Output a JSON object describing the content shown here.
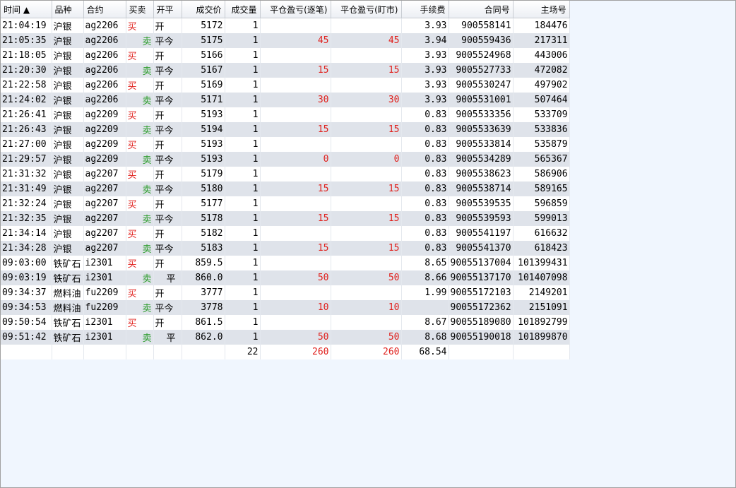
{
  "columns": [
    {
      "key": "time",
      "label": "时间 ▲"
    },
    {
      "key": "product",
      "label": "品种"
    },
    {
      "key": "contract",
      "label": "合约"
    },
    {
      "key": "side",
      "label": "买卖"
    },
    {
      "key": "offset",
      "label": "开平"
    },
    {
      "key": "price",
      "label": "成交价"
    },
    {
      "key": "qty",
      "label": "成交量"
    },
    {
      "key": "pnl_trade",
      "label": "平仓盈亏(逐笔)"
    },
    {
      "key": "pnl_mtm",
      "label": "平仓盈亏(盯市)"
    },
    {
      "key": "fee",
      "label": "手续费"
    },
    {
      "key": "order_no",
      "label": "合同号"
    },
    {
      "key": "exch_no",
      "label": "主场号"
    }
  ],
  "rows": [
    {
      "time": "21:04:19",
      "product": "沪银",
      "contract": "ag2206",
      "side": "买",
      "offset": "开",
      "price": "5172",
      "qty": "1",
      "pnl_trade": "",
      "pnl_mtm": "",
      "fee": "3.93",
      "order_no": "900558141",
      "exch_no": "184476"
    },
    {
      "time": "21:05:35",
      "product": "沪银",
      "contract": "ag2206",
      "side": "卖",
      "offset": "平今",
      "price": "5175",
      "qty": "1",
      "pnl_trade": "45",
      "pnl_mtm": "45",
      "fee": "3.94",
      "order_no": "900559436",
      "exch_no": "217311"
    },
    {
      "time": "21:18:05",
      "product": "沪银",
      "contract": "ag2206",
      "side": "买",
      "offset": "开",
      "price": "5166",
      "qty": "1",
      "pnl_trade": "",
      "pnl_mtm": "",
      "fee": "3.93",
      "order_no": "9005524968",
      "exch_no": "443006"
    },
    {
      "time": "21:20:30",
      "product": "沪银",
      "contract": "ag2206",
      "side": "卖",
      "offset": "平今",
      "price": "5167",
      "qty": "1",
      "pnl_trade": "15",
      "pnl_mtm": "15",
      "fee": "3.93",
      "order_no": "9005527733",
      "exch_no": "472082"
    },
    {
      "time": "21:22:58",
      "product": "沪银",
      "contract": "ag2206",
      "side": "买",
      "offset": "开",
      "price": "5169",
      "qty": "1",
      "pnl_trade": "",
      "pnl_mtm": "",
      "fee": "3.93",
      "order_no": "9005530247",
      "exch_no": "497902"
    },
    {
      "time": "21:24:02",
      "product": "沪银",
      "contract": "ag2206",
      "side": "卖",
      "offset": "平今",
      "price": "5171",
      "qty": "1",
      "pnl_trade": "30",
      "pnl_mtm": "30",
      "fee": "3.93",
      "order_no": "9005531001",
      "exch_no": "507464"
    },
    {
      "time": "21:26:41",
      "product": "沪银",
      "contract": "ag2209",
      "side": "买",
      "offset": "开",
      "price": "5193",
      "qty": "1",
      "pnl_trade": "",
      "pnl_mtm": "",
      "fee": "0.83",
      "order_no": "9005533356",
      "exch_no": "533709"
    },
    {
      "time": "21:26:43",
      "product": "沪银",
      "contract": "ag2209",
      "side": "卖",
      "offset": "平今",
      "price": "5194",
      "qty": "1",
      "pnl_trade": "15",
      "pnl_mtm": "15",
      "fee": "0.83",
      "order_no": "9005533639",
      "exch_no": "533836"
    },
    {
      "time": "21:27:00",
      "product": "沪银",
      "contract": "ag2209",
      "side": "买",
      "offset": "开",
      "price": "5193",
      "qty": "1",
      "pnl_trade": "",
      "pnl_mtm": "",
      "fee": "0.83",
      "order_no": "9005533814",
      "exch_no": "535879"
    },
    {
      "time": "21:29:57",
      "product": "沪银",
      "contract": "ag2209",
      "side": "卖",
      "offset": "平今",
      "price": "5193",
      "qty": "1",
      "pnl_trade": "0",
      "pnl_mtm": "0",
      "fee": "0.83",
      "order_no": "9005534289",
      "exch_no": "565367"
    },
    {
      "time": "21:31:32",
      "product": "沪银",
      "contract": "ag2207",
      "side": "买",
      "offset": "开",
      "price": "5179",
      "qty": "1",
      "pnl_trade": "",
      "pnl_mtm": "",
      "fee": "0.83",
      "order_no": "9005538623",
      "exch_no": "586906"
    },
    {
      "time": "21:31:49",
      "product": "沪银",
      "contract": "ag2207",
      "side": "卖",
      "offset": "平今",
      "price": "5180",
      "qty": "1",
      "pnl_trade": "15",
      "pnl_mtm": "15",
      "fee": "0.83",
      "order_no": "9005538714",
      "exch_no": "589165"
    },
    {
      "time": "21:32:24",
      "product": "沪银",
      "contract": "ag2207",
      "side": "买",
      "offset": "开",
      "price": "5177",
      "qty": "1",
      "pnl_trade": "",
      "pnl_mtm": "",
      "fee": "0.83",
      "order_no": "9005539535",
      "exch_no": "596859"
    },
    {
      "time": "21:32:35",
      "product": "沪银",
      "contract": "ag2207",
      "side": "卖",
      "offset": "平今",
      "price": "5178",
      "qty": "1",
      "pnl_trade": "15",
      "pnl_mtm": "15",
      "fee": "0.83",
      "order_no": "9005539593",
      "exch_no": "599013"
    },
    {
      "time": "21:34:14",
      "product": "沪银",
      "contract": "ag2207",
      "side": "买",
      "offset": "开",
      "price": "5182",
      "qty": "1",
      "pnl_trade": "",
      "pnl_mtm": "",
      "fee": "0.83",
      "order_no": "9005541197",
      "exch_no": "616632"
    },
    {
      "time": "21:34:28",
      "product": "沪银",
      "contract": "ag2207",
      "side": "卖",
      "offset": "平今",
      "price": "5183",
      "qty": "1",
      "pnl_trade": "15",
      "pnl_mtm": "15",
      "fee": "0.83",
      "order_no": "9005541370",
      "exch_no": "618423"
    },
    {
      "time": "09:03:00",
      "product": "铁矿石",
      "contract": "i2301",
      "side": "买",
      "offset": "开",
      "price": "859.5",
      "qty": "1",
      "pnl_trade": "",
      "pnl_mtm": "",
      "fee": "8.65",
      "order_no": "90055137004",
      "exch_no": "101399431"
    },
    {
      "time": "09:03:19",
      "product": "铁矿石",
      "contract": "i2301",
      "side": "卖",
      "offset": "平",
      "price": "860.0",
      "qty": "1",
      "pnl_trade": "50",
      "pnl_mtm": "50",
      "fee": "8.66",
      "order_no": "90055137170",
      "exch_no": "101407098"
    },
    {
      "time": "09:34:37",
      "product": "燃料油",
      "contract": "fu2209",
      "side": "买",
      "offset": "开",
      "price": "3777",
      "qty": "1",
      "pnl_trade": "",
      "pnl_mtm": "",
      "fee": "1.99",
      "order_no": "90055172103",
      "exch_no": "2149201"
    },
    {
      "time": "09:34:53",
      "product": "燃料油",
      "contract": "fu2209",
      "side": "卖",
      "offset": "平今",
      "price": "3778",
      "qty": "1",
      "pnl_trade": "10",
      "pnl_mtm": "10",
      "fee": "",
      "order_no": "90055172362",
      "exch_no": "2151091"
    },
    {
      "time": "09:50:54",
      "product": "铁矿石",
      "contract": "i2301",
      "side": "买",
      "offset": "开",
      "price": "861.5",
      "qty": "1",
      "pnl_trade": "",
      "pnl_mtm": "",
      "fee": "8.67",
      "order_no": "90055189080",
      "exch_no": "101892799"
    },
    {
      "time": "09:51:42",
      "product": "铁矿石",
      "contract": "i2301",
      "side": "卖",
      "offset": "平",
      "price": "862.0",
      "qty": "1",
      "pnl_trade": "50",
      "pnl_mtm": "50",
      "fee": "8.68",
      "order_no": "90055190018",
      "exch_no": "101899870"
    }
  ],
  "totals": {
    "qty": "22",
    "pnl_trade": "260",
    "pnl_mtm": "260",
    "fee": "68.54"
  },
  "colors": {
    "buy": "#e0201c",
    "sell": "#2d9c2d",
    "pnl": "#e0201c"
  }
}
